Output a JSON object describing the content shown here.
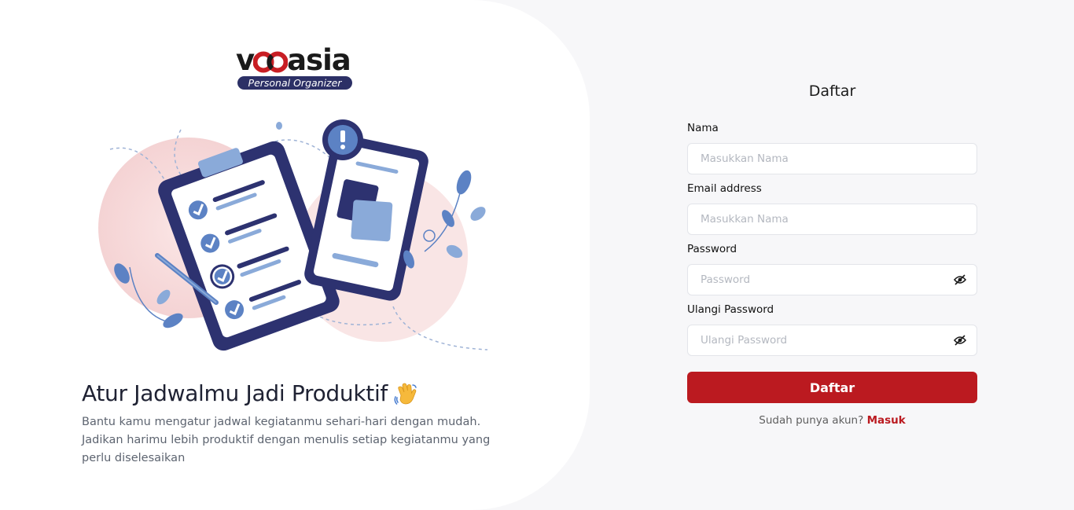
{
  "brand": {
    "logo_text_prefix": "v",
    "logo_text_suffix": "asia",
    "logo_full": "vocasia",
    "tagline": "Personal Organizer"
  },
  "hero": {
    "title": "Atur Jadwalmu Jadi Produktif",
    "description": "Bantu kamu mengatur jadwal kegiatanmu sehari-hari dengan mudah. Jadikan harimu lebih produktif dengan menulis setiap kegiatanmu yang perlu diselesaikan",
    "emoji": "waving-hand-icon"
  },
  "form": {
    "title": "Daftar",
    "fields": [
      {
        "label": "Nama",
        "placeholder": "Masukkan Nama",
        "value": ""
      },
      {
        "label": "Email address",
        "placeholder": "Masukkan Nama",
        "value": ""
      },
      {
        "label": "Password",
        "placeholder": "Password",
        "value": "",
        "icon": "eye-slash-icon"
      },
      {
        "label": "Ulangi Password",
        "placeholder": "Ulangi Password",
        "value": "",
        "icon": "eye-slash-icon"
      }
    ],
    "submit_label": "Daftar",
    "login_prompt": "Sudah punya akun?",
    "login_link": "Masuk"
  },
  "colors": {
    "accent": "#bb1a20",
    "brand_navy": "#2c3066",
    "background": "#f7f7f9",
    "panel": "#ffffff"
  }
}
